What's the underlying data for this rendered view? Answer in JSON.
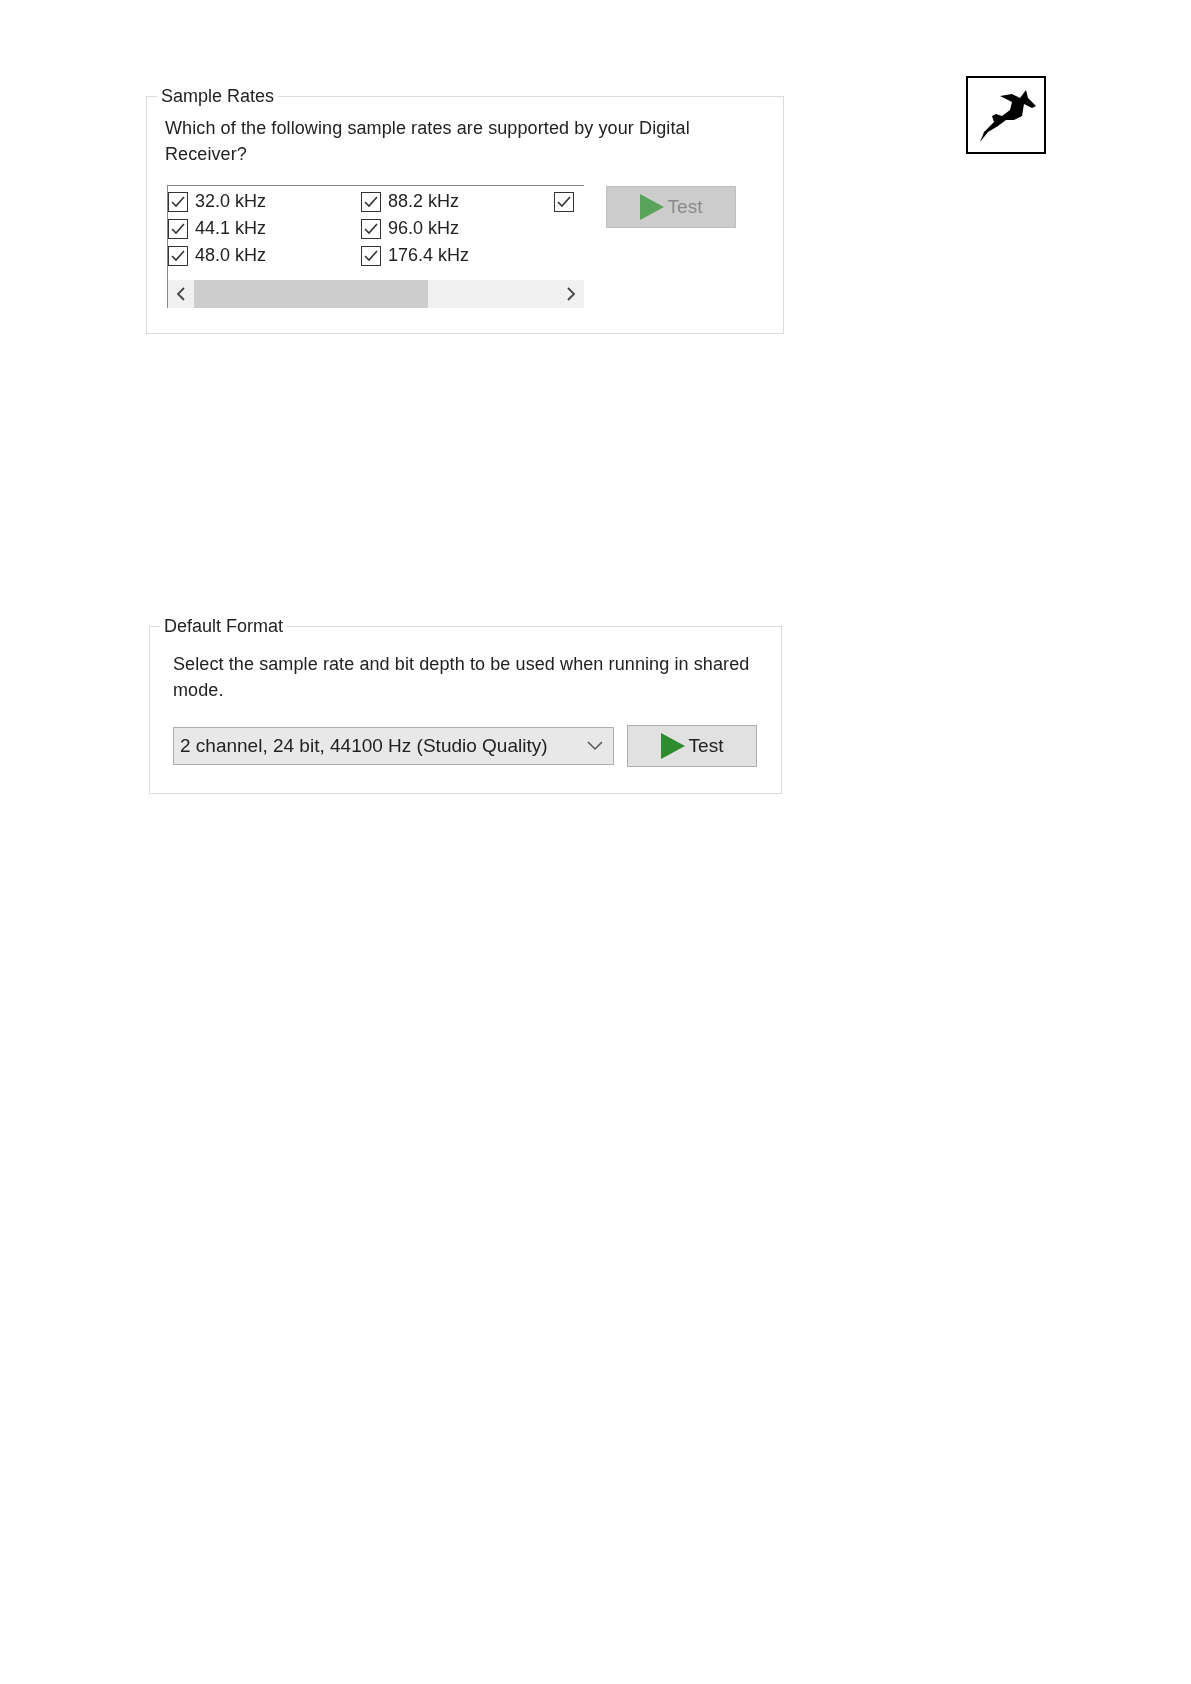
{
  "sample_rates": {
    "title": "Sample Rates",
    "prompt": "Which of the following sample rates are supported by your Digital Receiver?",
    "options": [
      {
        "label": "32.0 kHz",
        "checked": true
      },
      {
        "label": "44.1 kHz",
        "checked": true
      },
      {
        "label": "48.0 kHz",
        "checked": true
      },
      {
        "label": "88.2 kHz",
        "checked": true
      },
      {
        "label": "96.0 kHz",
        "checked": true
      },
      {
        "label": "176.4 kHz",
        "checked": true
      },
      {
        "checked": true
      }
    ],
    "test_button": {
      "label": "Test",
      "disabled": true
    }
  },
  "default_format": {
    "title": "Default Format",
    "prompt": "Select the sample rate and bit depth to be used when running in shared mode.",
    "format_select": {
      "value": "2 channel, 24 bit, 44100 Hz (Studio Quality)"
    },
    "test_button": {
      "label": "Test",
      "disabled": false
    }
  }
}
